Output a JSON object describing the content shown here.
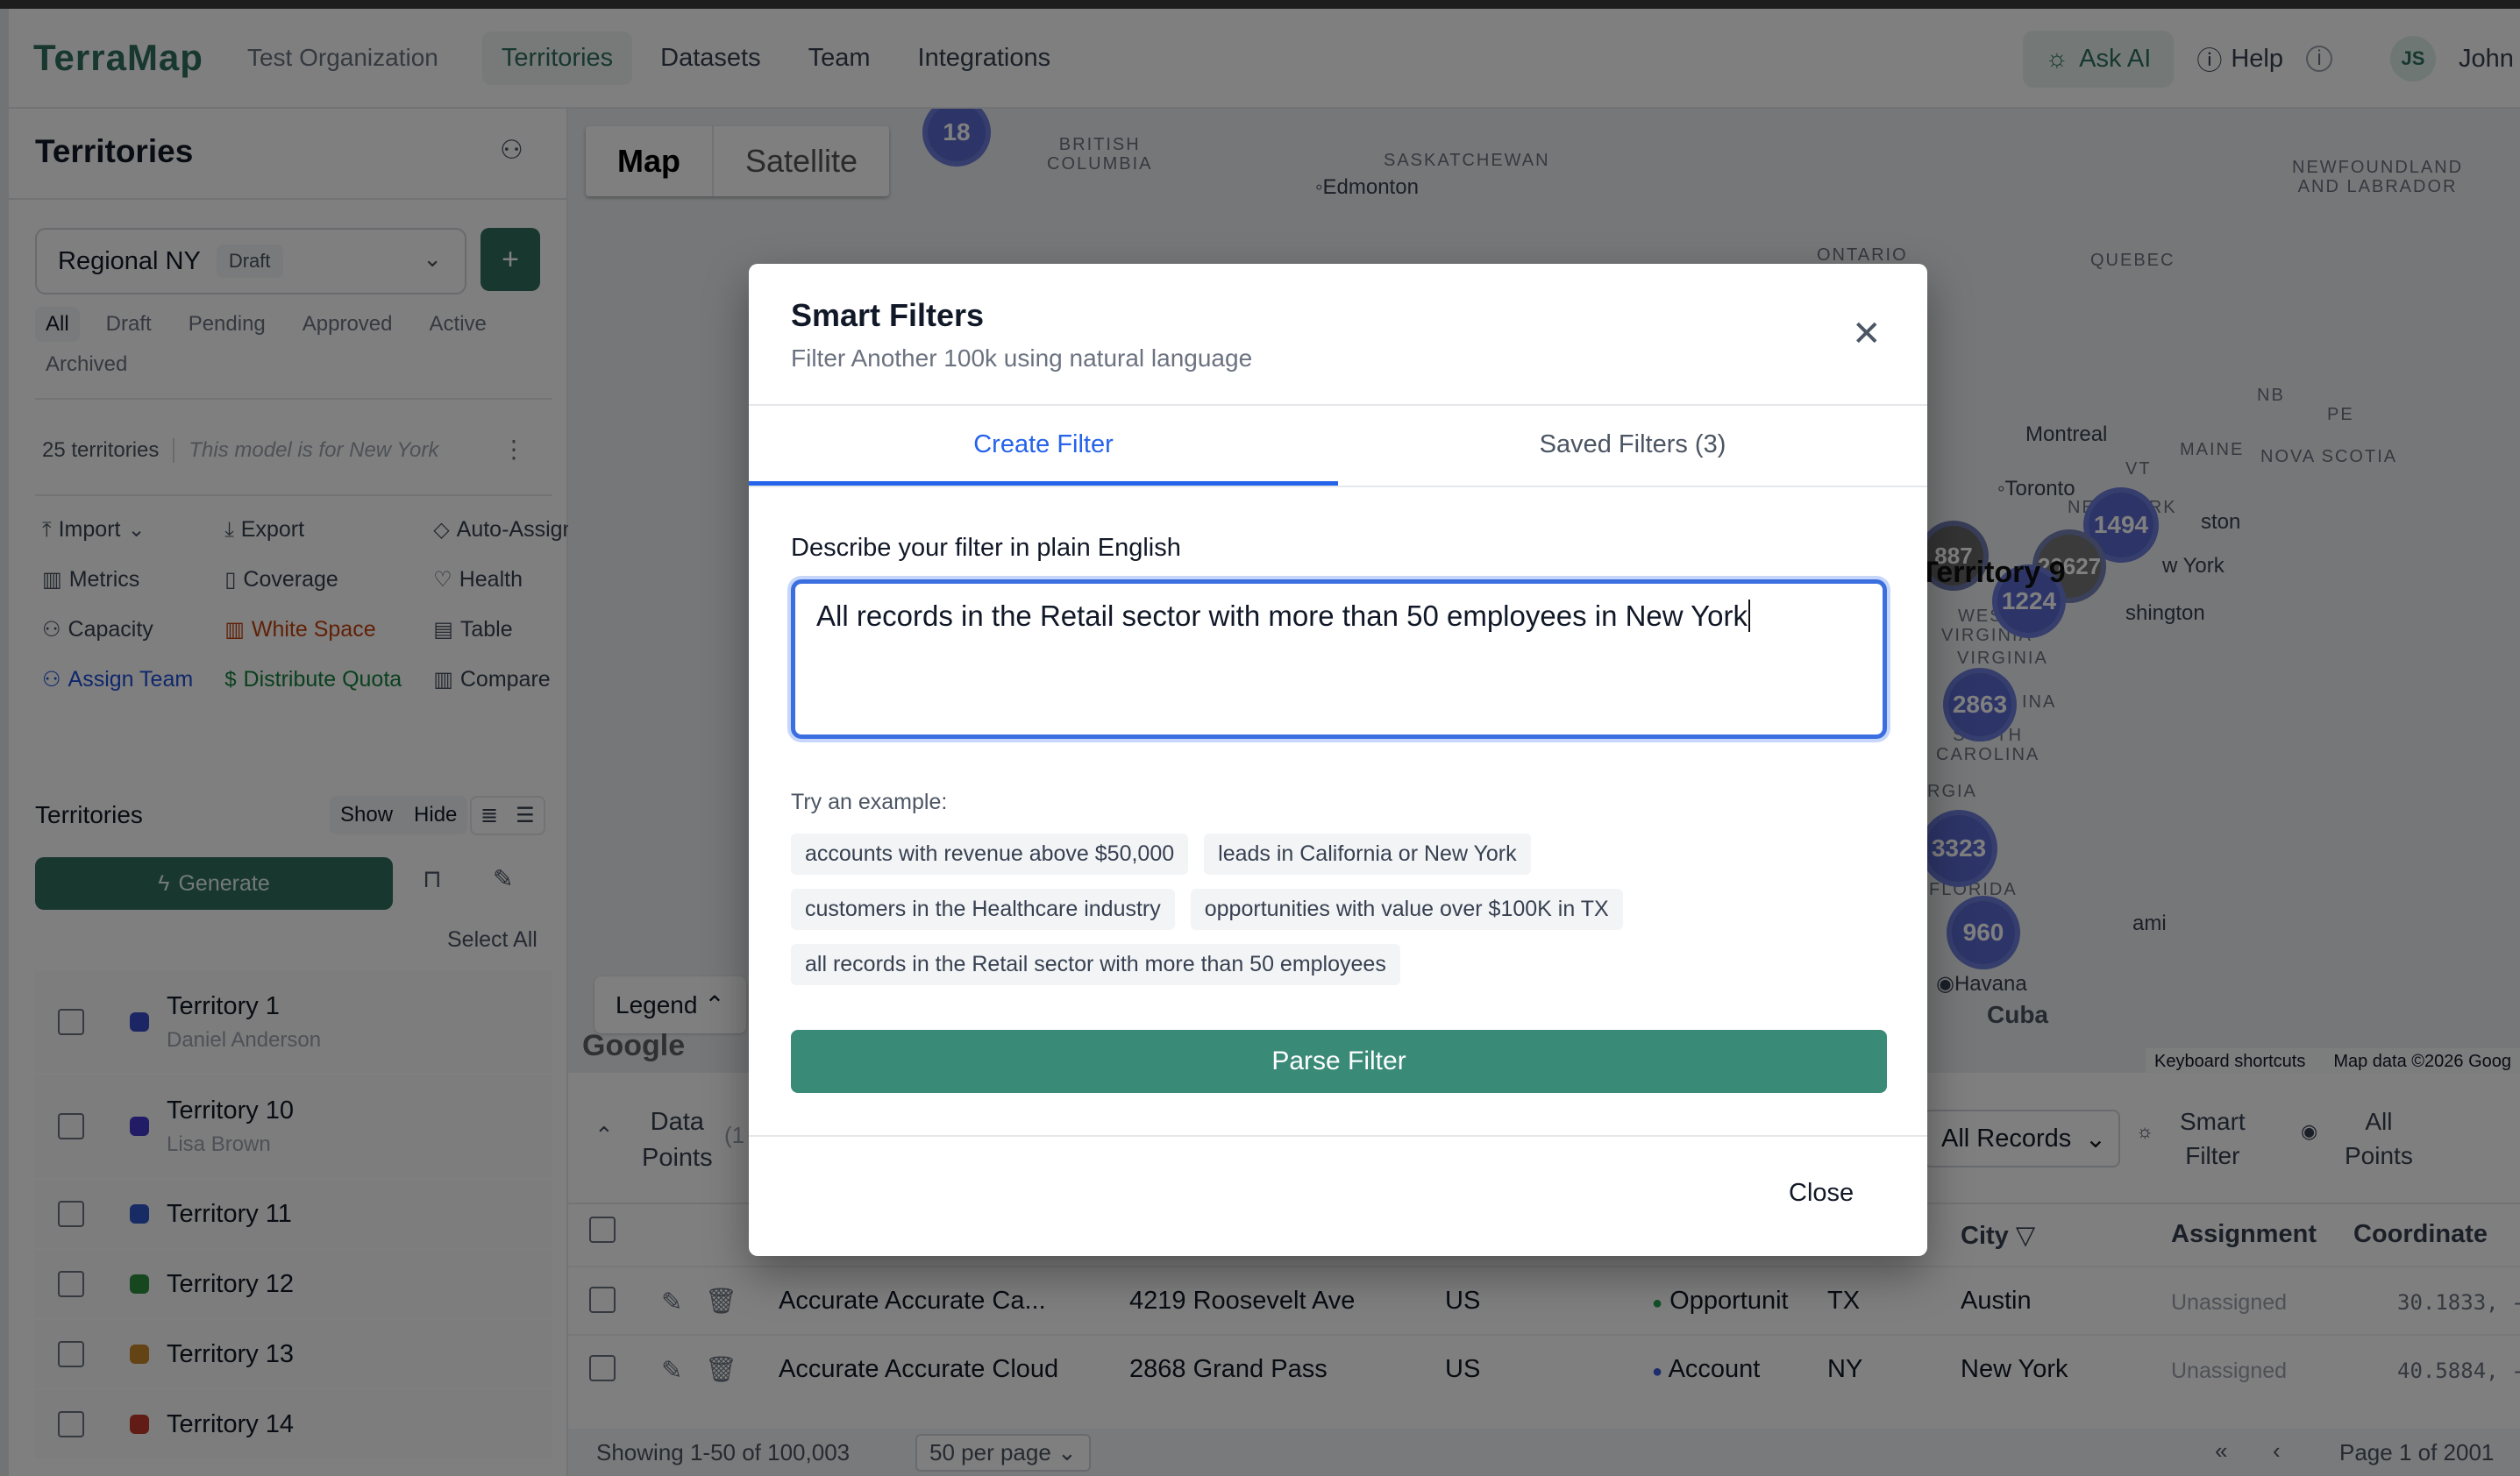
{
  "header": {
    "logo": "TerraMap",
    "org": "Test Organization",
    "nav": [
      "Territories",
      "Datasets",
      "Team",
      "Integrations"
    ],
    "ask_ai": "Ask AI",
    "help": "Help",
    "avatar_initials": "JS",
    "user_name": "John S"
  },
  "sidebar": {
    "title": "Territories",
    "model_name": "Regional NY",
    "model_status": "Draft",
    "add_label": "+",
    "status_tabs": [
      "All",
      "Draft",
      "Pending",
      "Approved",
      "Active",
      "Archived"
    ],
    "count": "25 territories",
    "note": "This model is for New York",
    "tools": [
      {
        "label": "Import",
        "icon": "⤒"
      },
      {
        "label": "Export",
        "icon": "⤓"
      },
      {
        "label": "Auto-Assign",
        "icon": "◇"
      },
      {
        "label": "Metrics",
        "icon": "▥"
      },
      {
        "label": "Coverage",
        "icon": "▯"
      },
      {
        "label": "Health",
        "icon": "♡"
      },
      {
        "label": "Capacity",
        "icon": "⚇"
      },
      {
        "label": "White Space",
        "icon": "▥"
      },
      {
        "label": "Table",
        "icon": "▤"
      },
      {
        "label": "Assign Team",
        "icon": "⚇"
      },
      {
        "label": "Distribute Quota",
        "icon": "$"
      },
      {
        "label": "Compare",
        "icon": "▥"
      }
    ],
    "list_title": "Territories",
    "show": "Show",
    "hide": "Hide",
    "generate": "Generate",
    "select_all": "Select All",
    "territories": [
      {
        "name": "Territory 1",
        "owner": "Daniel Anderson",
        "color": "#3b4cc8"
      },
      {
        "name": "Territory 10",
        "owner": "Lisa Brown",
        "color": "#4338ca"
      },
      {
        "name": "Territory 11",
        "owner": "",
        "color": "#2f56c9"
      },
      {
        "name": "Territory 12",
        "owner": "",
        "color": "#2f8f3f"
      },
      {
        "name": "Territory 13",
        "owner": "",
        "color": "#c9862a"
      },
      {
        "name": "Territory 14",
        "owner": "",
        "color": "#c0392b"
      }
    ]
  },
  "map": {
    "toggle": [
      "Map",
      "Satellite"
    ],
    "labels": {
      "bc": "BRITISH\nCOLUMBIA",
      "sk": "SASKATCHEWAN",
      "nl": "NEWFOUNDLAND\nAND LABRADOR",
      "on": "ONTARIO",
      "qc": "QUEBEC",
      "nb": "NB",
      "pe": "PE",
      "me": "MAINE",
      "ns": "NOVA SCOTIA",
      "vt": "VT",
      "ny": "NEW YORK",
      "wv": "WEST\nVIRGINIA",
      "va": "VIRGINIA",
      "sc": "SOUTH\nCAROLINA",
      "ga": "RGIA",
      "fl": "FLORIDA",
      "ina": "INA"
    },
    "cities": {
      "edmonton": "Edmonton",
      "montreal": "Montreal",
      "toronto": "Toronto",
      "boston": "ston",
      "nyc": "w York",
      "dc": "shington",
      "miami": "ami",
      "havana": "Havana",
      "cuba": "Cuba"
    },
    "clusters": [
      "18",
      "1494",
      "887",
      "20627",
      "1224",
      "2863",
      "3323",
      "960"
    ],
    "territory_label": "Territory 9",
    "legend": "Legend",
    "google": "Google",
    "keyboard": "Keyboard shortcuts",
    "mapdata": "Map data ©2026 Goog"
  },
  "table": {
    "title_line1": "Data",
    "title_line2": "Points",
    "count_fragment": "(1",
    "filter_select": "All Records",
    "smart_filter_line1": "Smart",
    "smart_filter_line2": "Filter",
    "all_points_line1": "All",
    "all_points_line2": "Points",
    "columns": [
      "City",
      "Assignment",
      "Coordinate"
    ],
    "rows": [
      {
        "name": "Accurate Accurate Ca...",
        "address": "4219 Roosevelt Ave",
        "country": "US",
        "type": "Opportunit",
        "type_color": "#22a050",
        "state": "TX",
        "city": "Austin",
        "assignment": "Unassigned",
        "coord": "30.1833, -"
      },
      {
        "name": "Accurate Accurate Cloud",
        "address": "2868 Grand Pass",
        "country": "US",
        "type": "Account",
        "type_color": "#3b5bdb",
        "state": "NY",
        "city": "New York",
        "assignment": "Unassigned",
        "coord": "40.5884, -"
      }
    ],
    "showing": "Showing 1-50 of 100,003",
    "per_page": "50 per page",
    "page_info": "Page 1 of 2001"
  },
  "modal": {
    "title": "Smart Filters",
    "subtitle": "Filter Another 100k using natural language",
    "tabs": [
      "Create Filter",
      "Saved Filters (3)"
    ],
    "label": "Describe your filter in plain English",
    "query": "All records in the Retail sector with more than 50 employees in New York",
    "try_label": "Try an example:",
    "examples": [
      "accounts with revenue above $50,000",
      "leads in California or New York",
      "customers in the Healthcare industry",
      "opportunities with value over $100K in TX",
      "all records in the Retail sector with more than 50 employees"
    ],
    "parse_button": "Parse Filter",
    "close_button": "Close"
  }
}
